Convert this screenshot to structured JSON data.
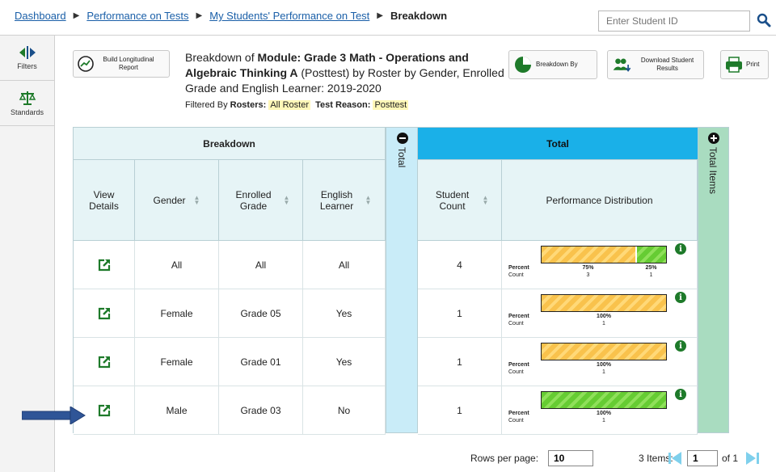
{
  "breadcrumb": {
    "items": [
      "Dashboard",
      "Performance on Tests",
      "My Students' Performance on Test"
    ],
    "current": "Breakdown"
  },
  "search": {
    "placeholder": "Enter Student ID",
    "icon": "search-icon"
  },
  "sidebar": {
    "items": [
      {
        "label": "Filters",
        "icon": "filters-icon"
      },
      {
        "label": "Standards",
        "icon": "scales-icon"
      }
    ]
  },
  "header": {
    "longitudinal_button": "Build Longitudinal Report",
    "title_prefix": "Breakdown of ",
    "title_module": "Module: Grade 3 Math - Operations and Algebraic Thinking A",
    "title_suffix": " (Posttest) by Roster by Gender, Enrolled Grade and English Learner: 2019-2020",
    "filtered_by_label": "Filtered By ",
    "rosters_label": "Rosters: ",
    "rosters_value": "All Roster",
    "test_reason_label": "Test Reason: ",
    "test_reason_value": "Posttest"
  },
  "toolbar": {
    "breakdown_by": "Breakdown By",
    "download": "Download Student Results",
    "print": "Print"
  },
  "table": {
    "breakdown_header": "Breakdown",
    "total_strip": "Total",
    "total_header": "Total",
    "total_items_strip": "Total Items",
    "columns": {
      "view_details": "View Details",
      "gender": "Gender",
      "enrolled_grade": "Enrolled Grade",
      "english_learner": "English Learner",
      "student_count": "Student Count",
      "performance_distribution": "Performance Distribution"
    },
    "dist_labels": {
      "percent": "Percent",
      "count": "Count"
    },
    "rows": [
      {
        "gender": "All",
        "grade": "All",
        "el": "All",
        "count": "4",
        "dist": [
          {
            "level": "below",
            "percent": "75%",
            "count": "3",
            "fraction": 0.75
          },
          {
            "level": "above",
            "percent": "25%",
            "count": "1",
            "fraction": 0.25
          }
        ]
      },
      {
        "gender": "Female",
        "grade": "Grade 05",
        "el": "Yes",
        "count": "1",
        "dist": [
          {
            "level": "below",
            "percent": "100%",
            "count": "1",
            "fraction": 1.0
          }
        ]
      },
      {
        "gender": "Female",
        "grade": "Grade 01",
        "el": "Yes",
        "count": "1",
        "dist": [
          {
            "level": "below",
            "percent": "100%",
            "count": "1",
            "fraction": 1.0
          }
        ]
      },
      {
        "gender": "Male",
        "grade": "Grade 03",
        "el": "No",
        "count": "1",
        "dist": [
          {
            "level": "above",
            "percent": "100%",
            "count": "1",
            "fraction": 1.0
          }
        ]
      }
    ]
  },
  "pagination": {
    "rows_per_page_label": "Rows per page:",
    "rows_per_page": "10",
    "items_label": "3 Items:",
    "page": "1",
    "of_label": "of 1"
  },
  "colors": {
    "total_band": "#1ab0e8",
    "total_strip": "#c9ecf8",
    "items_strip": "#a9dcc0",
    "below": "#f9c24c",
    "above": "#66cc33",
    "link": "#1a5fa8"
  }
}
